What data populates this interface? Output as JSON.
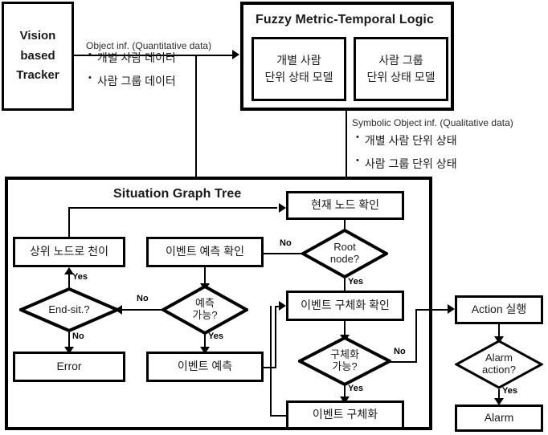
{
  "diagram": {
    "title": "Vision based Tracker / Fuzzy Metric-Temporal Logic / Situation Graph Tree flowchart",
    "colors": {
      "stroke": "#000000",
      "background": "#ffffff",
      "text": "#1a1a1a"
    }
  },
  "tracker": {
    "line1": "Vision",
    "line2": "based",
    "line3": "Tracker"
  },
  "quantitative": {
    "caption": "Object inf. (Quantitative  data)",
    "bullets": [
      "개별 사람 데이터",
      "사람 그룹 데이터"
    ],
    "bullet_glyph": "•"
  },
  "fmtl": {
    "title": "Fuzzy Metric-Temporal Logic",
    "models": [
      {
        "line1": "개별 사람",
        "line2": "단위 상태 모델"
      },
      {
        "line1": "사람 그룹",
        "line2": "단위 상태 모델"
      }
    ]
  },
  "qualitative": {
    "caption": "Symbolic  Object inf. (Qualitative  data)",
    "bullets": [
      "개별 사람 단위 상태",
      "사람 그룹 단위 상태"
    ],
    "bullet_glyph": "•"
  },
  "sgt": {
    "title": "Situation Graph Tree",
    "nodes": {
      "current_node": "현재 노드 확인",
      "parent_transition": "상위 노드로 천이",
      "event_predict_check": "이벤트 예측 확인",
      "event_predict": "이벤트 예측",
      "error": "Error",
      "event_concrete_check": "이벤트 구체화 확인",
      "event_concrete": "이벤트 구체화"
    },
    "decisions": {
      "root_node": {
        "line1": "Root",
        "line2": "node?"
      },
      "end_sit": {
        "line1": "End-sit.?",
        "line2": ""
      },
      "predict_possible": {
        "line1": "예측",
        "line2": "가능?"
      },
      "concrete_possible": {
        "line1": "구체화",
        "line2": "가능?"
      }
    }
  },
  "action": {
    "execute": "Action 실행",
    "alarm_decision": {
      "line1": "Alarm",
      "line2": "action?"
    },
    "alarm": "Alarm"
  },
  "edge_labels": {
    "root_no": "No",
    "root_yes": "Yes",
    "endsit_yes": "Yes",
    "endsit_no": "No",
    "predict_no": "No",
    "predict_yes": "Yes",
    "concrete_no": "No",
    "concrete_yes": "Yes",
    "alarm_yes": "Yes"
  }
}
